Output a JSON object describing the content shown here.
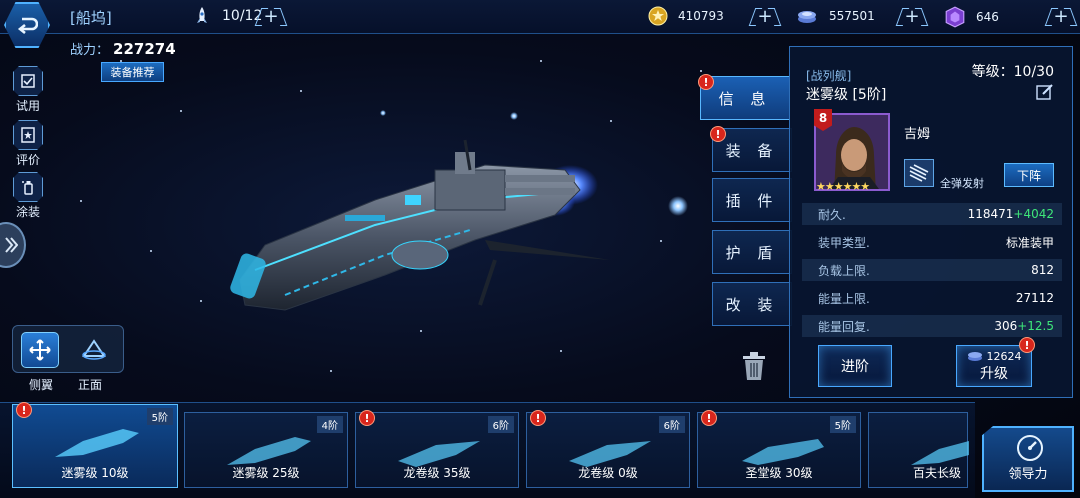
{
  "top_bar": {
    "dock_title": "[船坞]",
    "fleet_count": "10/12",
    "gold": "410793",
    "crystal": "557501",
    "gems": "646"
  },
  "power": {
    "label": "战力：",
    "value": "227274"
  },
  "equip_recommend": "装备推荐",
  "side_menu": {
    "trial": "试用",
    "review": "评价",
    "paint": "涂装"
  },
  "view_modes": {
    "side": "侧翼",
    "front": "正面"
  },
  "tabs": [
    "信 息",
    "装 备",
    "插 件",
    "护 盾",
    "改 装"
  ],
  "info_panel": {
    "ship_type": "[战列舰]",
    "ship_name": "迷雾级 [5阶]",
    "level": "等级：10/30",
    "captain_level": "8",
    "captain_stars": "★★★★★★",
    "captain_name": "吉姆",
    "skill_name": "全弹发射",
    "demote_label": "下阵",
    "stats": [
      {
        "key": "耐久.",
        "value": "118471",
        "bonus": "+4042"
      },
      {
        "key": "装甲类型.",
        "value": "标准装甲",
        "bonus": ""
      },
      {
        "key": "负载上限.",
        "value": "812",
        "bonus": ""
      },
      {
        "key": "能量上限.",
        "value": "27112",
        "bonus": ""
      },
      {
        "key": "能量回复.",
        "value": "306",
        "bonus": "+12.5"
      }
    ],
    "advance_label": "进阶",
    "upgrade_cost": "12624",
    "upgrade_label": "升级"
  },
  "ship_cards": [
    {
      "name": "迷雾级 10级",
      "tier": "5阶"
    },
    {
      "name": "迷雾级 25级",
      "tier": "4阶"
    },
    {
      "name": "龙卷级 35级",
      "tier": "6阶"
    },
    {
      "name": "龙卷级 0级",
      "tier": "6阶"
    },
    {
      "name": "圣堂级 30级",
      "tier": "5阶"
    },
    {
      "name": "百夫长级",
      "tier": ""
    }
  ],
  "guide_label": "领导力",
  "colors": {
    "accent": "#48a8ff",
    "bonus_green": "#3ee67a",
    "warning_red": "#d8261c",
    "panel_bg": "#081630"
  }
}
